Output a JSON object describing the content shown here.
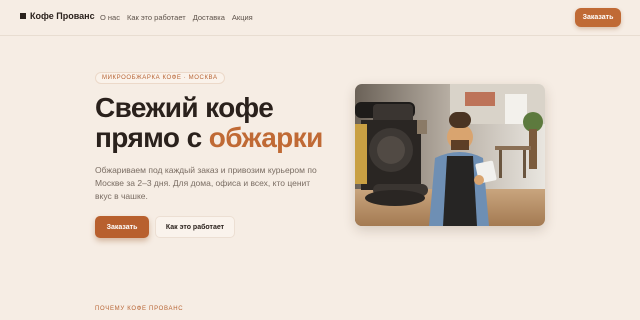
{
  "header": {
    "brand": "Кофе Прованс",
    "nav": [
      "О нас",
      "Как это работает",
      "Доставка",
      "Акция"
    ],
    "order_label": "Заказать"
  },
  "hero": {
    "badge": "МИКРООБЖАРКА КОФЕ · МОСКВА",
    "title_line1": "Свежий кофе",
    "title_line2_plain": "прямо с ",
    "title_line2_accent": "обжарки",
    "lead": "Обжариваем под каждый заказ и привозим курьером по Москве за 2–3 дня. Для дома, офиса и всех, кто ценит вкус в чашке.",
    "primary_label": "Заказать",
    "secondary_label": "Как это работает"
  },
  "section": {
    "label": "ПОЧЕМУ КОФЕ ПРОВАНС"
  },
  "colors": {
    "background": "#f6ede4",
    "accent": "#c06a35",
    "text": "#2a211c"
  }
}
